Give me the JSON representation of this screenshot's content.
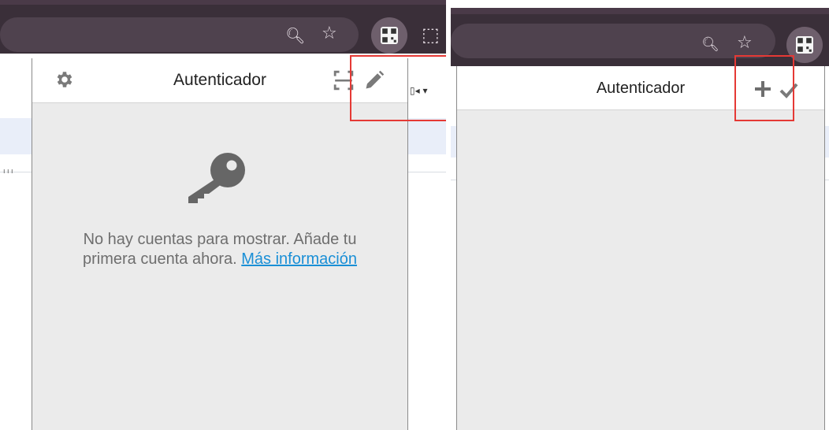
{
  "left_panel": {
    "title": "Autenticador",
    "empty_message": "No hay cuentas para mostrar. Añade tu primera cuenta ahora.",
    "learn_more": "Más información",
    "icons": [
      "gear-icon",
      "scan-qr-icon",
      "pencil-icon",
      "key-icon"
    ]
  },
  "right_panel": {
    "title": "Autenticador",
    "icons": [
      "plus-icon",
      "checkmark-icon"
    ]
  },
  "browser": {
    "icons": [
      "zoom-icon",
      "star-icon",
      "authenticator-extension-icon",
      "extensions-icon"
    ]
  },
  "colors": {
    "chrome_toolbar": "#3a2f39",
    "popup_bg": "#ebebeb",
    "header_bg": "#ffffff",
    "icon_grey": "#7a7a7a",
    "link": "#1a8fd6",
    "highlight": "#e53935"
  }
}
